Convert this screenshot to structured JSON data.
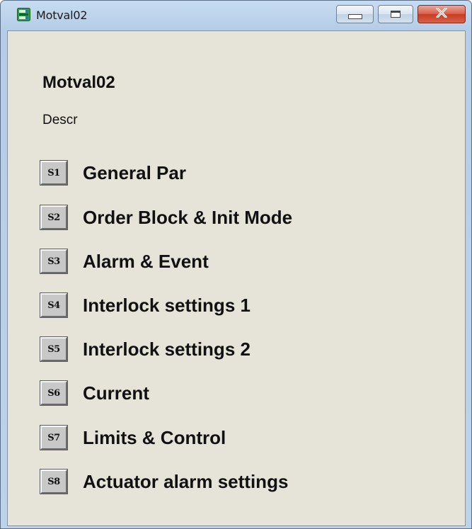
{
  "window": {
    "title": "Motval02"
  },
  "header": {
    "title": "Motval02",
    "description": "Descr"
  },
  "sections": [
    {
      "button": "S1",
      "label": "General Par"
    },
    {
      "button": "S2",
      "label": "Order Block & Init Mode"
    },
    {
      "button": "S3",
      "label": "Alarm & Event"
    },
    {
      "button": "S4",
      "label": "Interlock settings 1"
    },
    {
      "button": "S5",
      "label": "Interlock settings 2"
    },
    {
      "button": "S6",
      "label": "Current"
    },
    {
      "button": "S7",
      "label": "Limits & Control"
    },
    {
      "button": "S8",
      "label": "Actuator alarm settings"
    }
  ],
  "icons": {
    "app": "app-window-icon",
    "minimize": "minimize-icon",
    "maximize": "maximize-icon",
    "close": "close-icon"
  },
  "colors": {
    "client_background": "#e6e4d8",
    "button_face": "#c8c8c8",
    "close_button": "#c73b22"
  }
}
